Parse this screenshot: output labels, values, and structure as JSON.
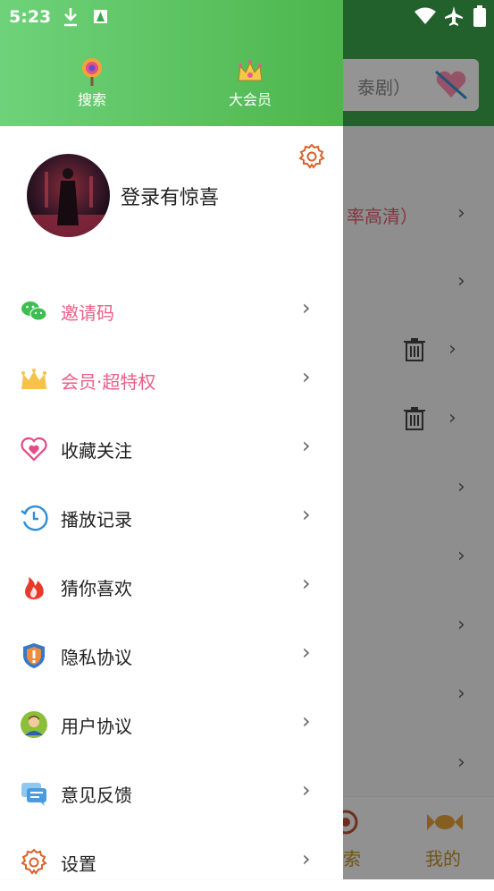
{
  "status_bar": {
    "time": "5:23"
  },
  "drawer": {
    "header_tabs": [
      {
        "label": "搜索",
        "icon": "lollipop-search-icon"
      },
      {
        "label": "大会员",
        "icon": "crown-icon"
      }
    ],
    "profile": {
      "name": "登录有惊喜",
      "avatar": "avatar-image"
    },
    "settings_icon": "gear-icon",
    "menu": [
      {
        "label": "邀请码",
        "icon": "wechat-icon",
        "highlight": true
      },
      {
        "label": "会员·超特权",
        "icon": "crown-icon",
        "highlight": true
      },
      {
        "label": "收藏关注",
        "icon": "heart-icon",
        "highlight": false
      },
      {
        "label": "播放记录",
        "icon": "history-clock-icon",
        "highlight": false
      },
      {
        "label": "猜你喜欢",
        "icon": "flame-icon",
        "highlight": false
      },
      {
        "label": "隐私协议",
        "icon": "shield-icon",
        "highlight": false
      },
      {
        "label": "用户协议",
        "icon": "user-icon",
        "highlight": false
      },
      {
        "label": "意见反馈",
        "icon": "feedback-chat-icon",
        "highlight": false
      },
      {
        "label": "设置",
        "icon": "gear-icon",
        "highlight": false
      }
    ]
  },
  "background": {
    "search_text": "泰剧）",
    "list_text": "率高清）",
    "bottom_tabs": [
      "索",
      "我的"
    ]
  },
  "colors": {
    "header_green": "#4db64c",
    "highlight_pink": "#ea5f86"
  }
}
